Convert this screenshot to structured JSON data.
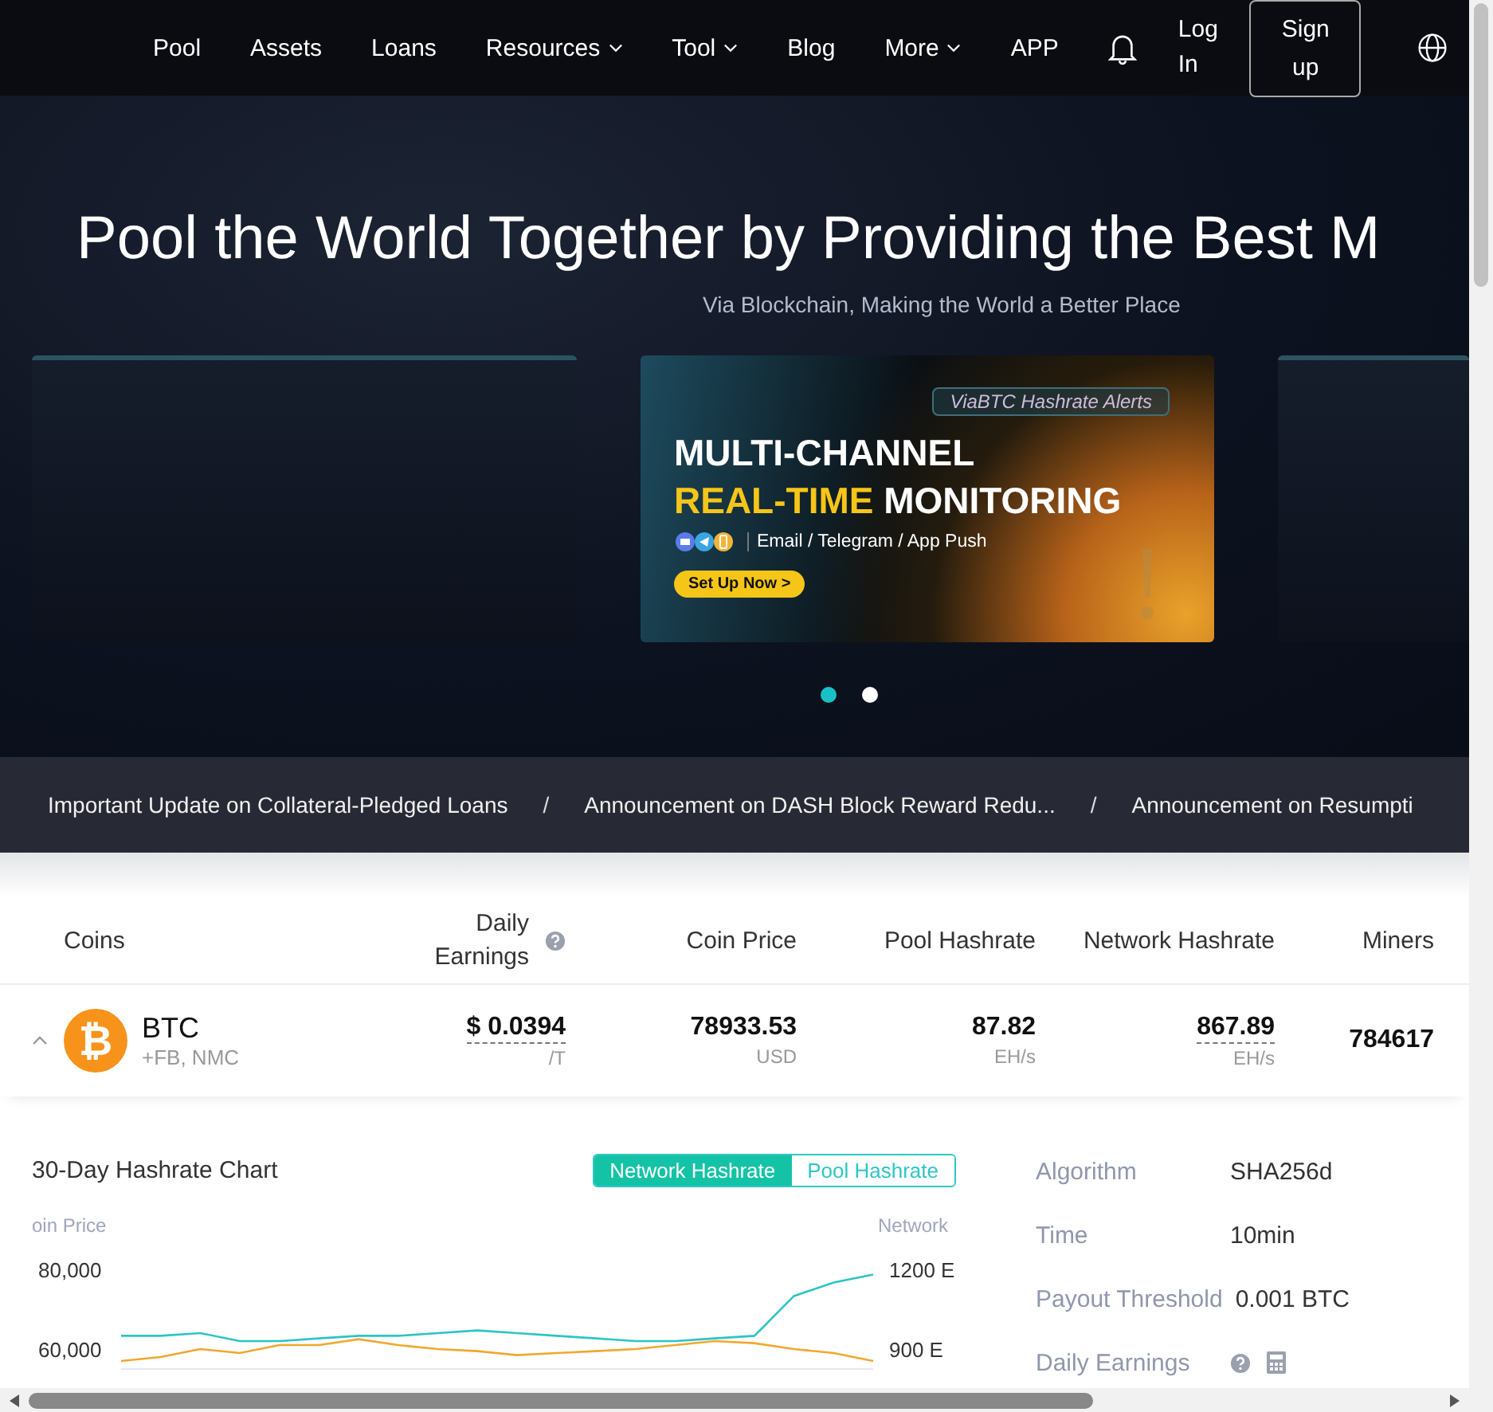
{
  "nav": {
    "items": [
      {
        "label": "Pool",
        "dropdown": false
      },
      {
        "label": "Assets",
        "dropdown": false
      },
      {
        "label": "Loans",
        "dropdown": false
      },
      {
        "label": "Resources",
        "dropdown": true
      },
      {
        "label": "Tool",
        "dropdown": true
      },
      {
        "label": "Blog",
        "dropdown": false
      },
      {
        "label": "More",
        "dropdown": true
      },
      {
        "label": "APP",
        "dropdown": false
      }
    ],
    "login": "Log In",
    "signup": "Sign up"
  },
  "hero": {
    "title": "Pool the World Together by Providing the Best M",
    "subtitle": "Via Blockchain, Making the World a Better Place"
  },
  "banner": {
    "tag": "ViaBTC Hashrate Alerts",
    "headline": [
      [
        {
          "text": "MULTI-CHANNEL",
          "highlight": false
        }
      ],
      [
        {
          "text": "REAL-TIME",
          "highlight": true
        },
        {
          "text": " MONITORING",
          "highlight": false
        }
      ]
    ],
    "channels": "Email / Telegram / App Push",
    "button": "Set Up Now >"
  },
  "carousel": {
    "dots": [
      {
        "selected": true
      },
      {
        "selected": false
      }
    ]
  },
  "announcements": [
    {
      "kind": "link",
      "text": "Important Update on Collateral-Pledged Loans"
    },
    {
      "kind": "separator",
      "text": "/"
    },
    {
      "kind": "link",
      "text": "Announcement on DASH Block Reward Redu..."
    },
    {
      "kind": "separator",
      "text": "/"
    },
    {
      "kind": "link",
      "text": "Announcement on Resumpti"
    }
  ],
  "table": {
    "columns": [
      {
        "label": "Coins",
        "help": false
      },
      {
        "label": "Daily Earnings",
        "help": true
      },
      {
        "label": "Coin Price",
        "help": false
      },
      {
        "label": "Pool Hashrate",
        "help": false
      },
      {
        "label": "Network Hashrate",
        "help": false
      },
      {
        "label": "Miners",
        "help": false
      }
    ],
    "rows": [
      {
        "expanded": true,
        "cells": [
          {
            "kind": "coin",
            "glyph": "₿",
            "value": "BTC",
            "unit": "+FB, NMC"
          },
          {
            "kind": "value",
            "value": "$ 0.0394",
            "unit": "/T",
            "dotted": true
          },
          {
            "kind": "value",
            "value": "78933.53",
            "unit": "USD",
            "dotted": false
          },
          {
            "kind": "value",
            "value": "87.82",
            "unit": "EH/s",
            "dotted": false
          },
          {
            "kind": "value",
            "value": "867.89",
            "unit": "EH/s",
            "dotted": true
          },
          {
            "kind": "value",
            "value": "784617",
            "dotted": false
          }
        ]
      }
    ]
  },
  "hashrate_chart": {
    "title": "30-Day Hashrate Chart",
    "toggle": [
      {
        "label": "Network Hashrate",
        "selected": true
      },
      {
        "label": "Pool Hashrate",
        "selected": false
      }
    ],
    "chart_data": {
      "type": "line",
      "ylabel": "oin Price",
      "y2label": "Network",
      "ylim": [
        55000,
        80000
      ],
      "y2lim": [
        825,
        1200
      ],
      "yticks": [
        {
          "value": 60000,
          "label": "60,000"
        },
        {
          "value": 80000,
          "label": "80,000"
        }
      ],
      "y2ticks": [
        {
          "value": 900,
          "label": "900 E"
        },
        {
          "value": 1200,
          "label": "1200 E"
        }
      ],
      "series": [
        {
          "color": "#2ec4c4",
          "axis": "y2",
          "values": [
            950,
            950,
            960,
            930,
            930,
            940,
            950,
            950,
            960,
            970,
            960,
            950,
            940,
            930,
            930,
            940,
            950,
            1100,
            1150,
            1180
          ]
        },
        {
          "color": "#f0a830",
          "axis": "y",
          "values": [
            57000,
            58000,
            60000,
            59000,
            61000,
            61000,
            62500,
            61000,
            60000,
            59500,
            58500,
            59000,
            59500,
            60000,
            61000,
            62000,
            61500,
            60000,
            59000,
            57000
          ]
        }
      ]
    }
  },
  "info": [
    {
      "label": "Algorithm",
      "value": "SHA256d",
      "kind": "text"
    },
    {
      "label": "Time",
      "value": "10min",
      "kind": "text"
    },
    {
      "label": "Payout Threshold",
      "value": "0.001 BTC",
      "kind": "text"
    },
    {
      "label": "Daily Earnings",
      "kind": "tools"
    }
  ]
}
